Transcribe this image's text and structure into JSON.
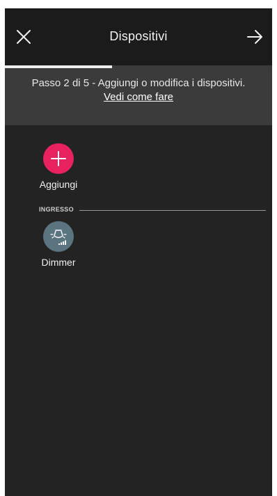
{
  "header": {
    "title": "Dispositivi",
    "close_icon": "close-icon",
    "next_icon": "arrow-right-icon"
  },
  "progress": {
    "step": 2,
    "total_steps": 5,
    "fraction": 0.4
  },
  "instructions": {
    "text": "Passo 2 di 5 - Aggiungi o modifica i dispositivi.",
    "link": "Vedi come fare"
  },
  "add_device": {
    "label": "Aggiungi",
    "icon": "plus-icon",
    "color": "#e8215f"
  },
  "section": {
    "label": "INGRESSO"
  },
  "devices": [
    {
      "label": "Dimmer",
      "icon": "dimmer-lamp-icon",
      "color": "#5a7480"
    }
  ],
  "colors": {
    "background": "#232323",
    "header": "#1b1b1b",
    "banner": "#3b3b3b",
    "accent": "#e8215f"
  }
}
